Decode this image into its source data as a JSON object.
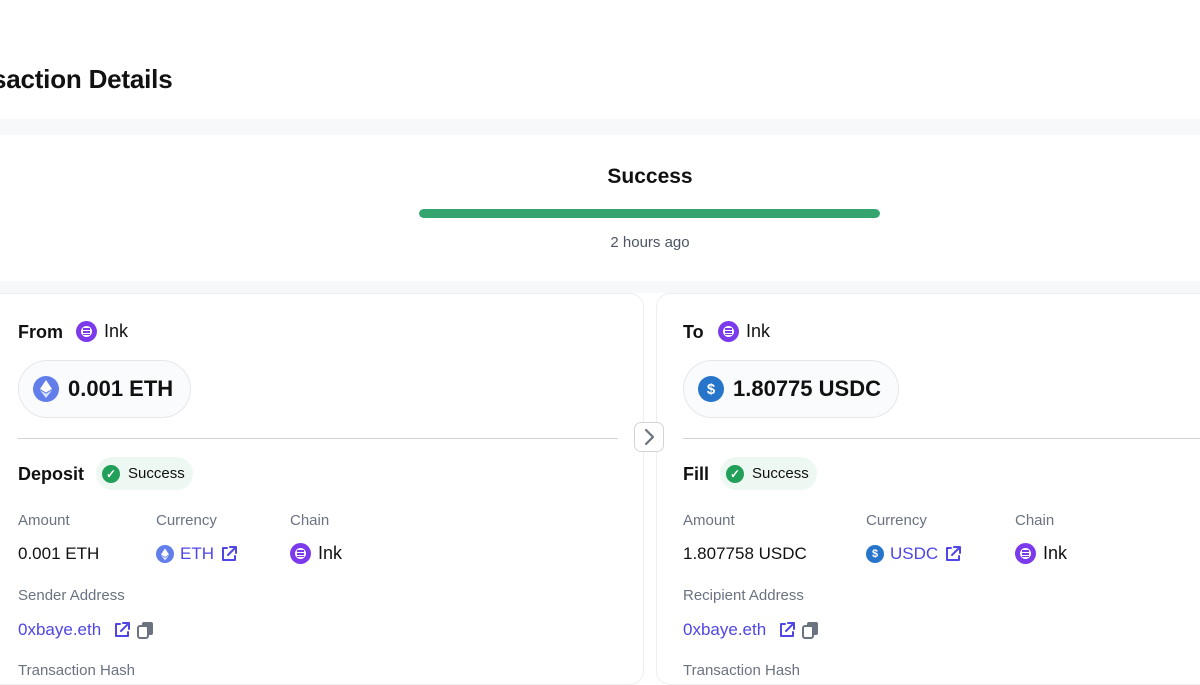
{
  "page": {
    "title": "ansaction Details"
  },
  "status": {
    "label": "Success",
    "time": "2 hours ago",
    "progress": 1.0
  },
  "colors": {
    "success": "#34a56f",
    "link": "#4f46e5",
    "ink": "#7c3aed",
    "eth": "#627eea",
    "usdc": "#2775ca"
  },
  "from": {
    "heading": "From",
    "chain": "Ink",
    "amount": "0.001 ETH",
    "section": "Deposit",
    "section_status": "Success",
    "amount_label": "Amount",
    "amount_value": "0.001 ETH",
    "currency_label": "Currency",
    "currency_value": "ETH",
    "chain_label": "Chain",
    "chain_value": "Ink",
    "address_label": "Sender Address",
    "address": "0xbaye.eth",
    "hash_label": "Transaction Hash",
    "icons": {
      "amount": "eth-icon",
      "chain": "ink-icon",
      "external": "external-link-icon",
      "copy": "copy-icon"
    }
  },
  "to": {
    "heading": "To",
    "chain": "Ink",
    "amount": "1.80775 USDC",
    "section": "Fill",
    "section_status": "Success",
    "amount_label": "Amount",
    "amount_value": "1.807758 USDC",
    "currency_label": "Currency",
    "currency_value": "USDC",
    "chain_label": "Chain",
    "chain_value": "Ink",
    "address_label": "Recipient Address",
    "address": "0xbaye.eth",
    "hash_label": "Transaction Hash",
    "icons": {
      "amount": "usdc-icon",
      "chain": "ink-icon",
      "external": "external-link-icon",
      "copy": "copy-icon"
    }
  },
  "navigation": {
    "arrow_icon": "chevron-right-icon"
  }
}
